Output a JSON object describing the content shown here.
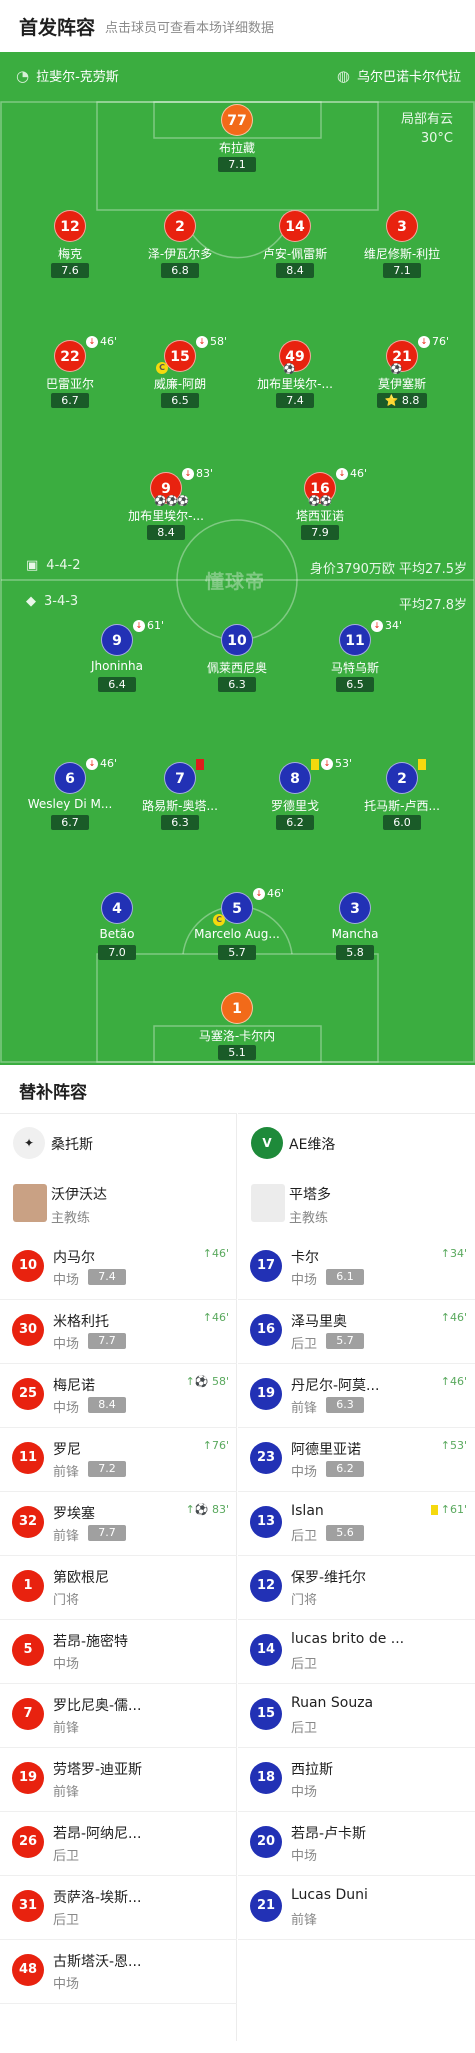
{
  "header": {
    "title": "首发阵容",
    "subtitle": "点击球员可查看本场详细数据"
  },
  "pitch": {
    "home_team": "拉斐尔-克劳斯",
    "away_team": "乌尔巴诺卡尔代拉",
    "weather": "局部有云",
    "temperature": "30°C",
    "watermark": "懂球帝",
    "home_formation": "4-4-2",
    "home_stats": "身价3790万欧 平均27.5岁",
    "away_formation": "3-4-3",
    "away_stats": "平均27.8岁",
    "players": [
      {
        "num": "77",
        "name": "布拉藏",
        "rating": "7.1",
        "color": "o"
      },
      {
        "num": "12",
        "name": "梅克",
        "rating": "7.6",
        "color": "r"
      },
      {
        "num": "2",
        "name": "泽-伊瓦尔多",
        "rating": "6.8",
        "color": "r"
      },
      {
        "num": "14",
        "name": "卢安-佩雷斯",
        "rating": "8.4",
        "color": "r"
      },
      {
        "num": "3",
        "name": "维尼修斯-利拉",
        "rating": "7.1",
        "color": "r"
      },
      {
        "num": "22",
        "name": "巴雷亚尔",
        "rating": "6.7",
        "color": "r",
        "sub": "46'"
      },
      {
        "num": "15",
        "name": "威廉-阿朗",
        "rating": "6.5",
        "color": "r",
        "sub": "58'",
        "captain": "C"
      },
      {
        "num": "49",
        "name": "加布里埃尔-...",
        "rating": "7.4",
        "color": "r",
        "events": "⚽"
      },
      {
        "num": "21",
        "name": "莫伊塞斯",
        "rating": "8.8",
        "color": "r",
        "sub": "76'",
        "events": "⚽",
        "best": "⭐"
      },
      {
        "num": "9",
        "name": "加布里埃尔-...",
        "rating": "8.4",
        "color": "r",
        "sub": "83'",
        "events": "⚽⚽⚽"
      },
      {
        "num": "16",
        "name": "塔西亚诺",
        "rating": "7.9",
        "color": "r",
        "sub": "46'",
        "events": "⚽⚽"
      },
      {
        "num": "9",
        "name": "Jhoninha",
        "rating": "6.4",
        "color": "b",
        "sub": "61'"
      },
      {
        "num": "10",
        "name": "佩莱西尼奥",
        "rating": "6.3",
        "color": "b"
      },
      {
        "num": "11",
        "name": "马特乌斯",
        "rating": "6.5",
        "color": "b",
        "sub": "34'"
      },
      {
        "num": "6",
        "name": "Wesley Di M...",
        "rating": "6.7",
        "color": "b",
        "sub": "46'"
      },
      {
        "num": "7",
        "name": "路易斯-奥塔...",
        "rating": "6.3",
        "color": "b",
        "red": true
      },
      {
        "num": "8",
        "name": "罗德里戈",
        "rating": "6.2",
        "color": "b",
        "sub": "53'",
        "yellow": true
      },
      {
        "num": "2",
        "name": "托马斯-卢西...",
        "rating": "6.0",
        "color": "b",
        "yellow": true
      },
      {
        "num": "4",
        "name": "Betão",
        "rating": "7.0",
        "color": "b"
      },
      {
        "num": "5",
        "name": "Marcelo Aug...",
        "rating": "5.7",
        "color": "b",
        "sub": "46'",
        "captain": "C"
      },
      {
        "num": "3",
        "name": "Mancha",
        "rating": "5.8",
        "color": "b"
      },
      {
        "num": "1",
        "name": "马塞洛-卡尔内",
        "rating": "5.1",
        "color": "o"
      }
    ]
  },
  "subs": {
    "title": "替补阵容",
    "home": {
      "team": "桑托斯",
      "coach": {
        "name": "沃伊沃达",
        "role": "主教练"
      },
      "list": [
        {
          "num": "10",
          "name": "内马尔",
          "pos": "中场",
          "rating": "7.4",
          "ev": "46'"
        },
        {
          "num": "30",
          "name": "米格利托",
          "pos": "中场",
          "rating": "7.7",
          "ev": "46'"
        },
        {
          "num": "25",
          "name": "梅尼诺",
          "pos": "中场",
          "rating": "8.4",
          "ev": "⚽ 58'"
        },
        {
          "num": "11",
          "name": "罗尼",
          "pos": "前锋",
          "rating": "7.2",
          "ev": "76'"
        },
        {
          "num": "32",
          "name": "罗埃塞",
          "pos": "前锋",
          "rating": "7.7",
          "ev": "⚽ 83'"
        },
        {
          "num": "1",
          "name": "第欧根尼",
          "pos": "门将"
        },
        {
          "num": "5",
          "name": "若昂-施密特",
          "pos": "中场"
        },
        {
          "num": "7",
          "name": "罗比尼奥-儒...",
          "pos": "前锋"
        },
        {
          "num": "19",
          "name": "劳塔罗-迪亚斯",
          "pos": "前锋"
        },
        {
          "num": "26",
          "name": "若昂-阿纳尼...",
          "pos": "后卫"
        },
        {
          "num": "31",
          "name": "贡萨洛-埃斯...",
          "pos": "后卫"
        },
        {
          "num": "48",
          "name": "古斯塔沃-恩...",
          "pos": "中场"
        }
      ]
    },
    "away": {
      "team": "AE维洛",
      "coach": {
        "name": "平塔多",
        "role": "主教练"
      },
      "list": [
        {
          "num": "17",
          "name": "卡尔",
          "pos": "中场",
          "rating": "6.1",
          "ev": "34'"
        },
        {
          "num": "16",
          "name": "泽马里奥",
          "pos": "后卫",
          "rating": "5.7",
          "ev": "46'"
        },
        {
          "num": "19",
          "name": "丹尼尔-阿莫...",
          "pos": "前锋",
          "rating": "6.3",
          "ev": "46'"
        },
        {
          "num": "23",
          "name": "阿德里亚诺",
          "pos": "中场",
          "rating": "6.2",
          "ev": "53'"
        },
        {
          "num": "13",
          "name": "Islan",
          "pos": "后卫",
          "rating": "5.6",
          "ev": "61'",
          "yellow": true
        },
        {
          "num": "12",
          "name": "保罗-维托尔",
          "pos": "门将"
        },
        {
          "num": "14",
          "name": "lucas brito de ...",
          "pos": "后卫"
        },
        {
          "num": "15",
          "name": "Ruan Souza",
          "pos": "后卫"
        },
        {
          "num": "18",
          "name": "西拉斯",
          "pos": "中场"
        },
        {
          "num": "20",
          "name": "若昂-卢卡斯",
          "pos": "中场"
        },
        {
          "num": "21",
          "name": "Lucas Duni",
          "pos": "前锋"
        }
      ]
    }
  }
}
